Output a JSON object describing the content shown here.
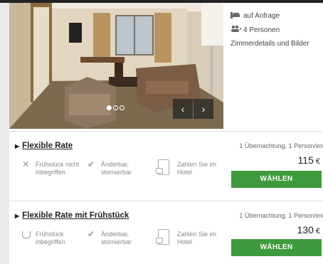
{
  "room": {
    "availability": "auf Anfrage",
    "capacity": "4 Personen",
    "details_link": "Zimmerdetails und Bilder",
    "gallery": {
      "slide_count": 3,
      "active_slide": 1
    }
  },
  "gallery_nav": {
    "prev": "‹",
    "next": "›"
  },
  "rates": [
    {
      "title": "Flexible Rate",
      "features": [
        {
          "icon": "x-icon",
          "text": "Frühstück nicht inbegriffen"
        },
        {
          "icon": "check-icon",
          "text": "Änderbar, stornierbar"
        },
        {
          "icon": "phone-hand-icon",
          "text": "Zahlen Sie im Hotel"
        }
      ],
      "per": "1 Übernachtung, 1 Person/en",
      "price": "115",
      "currency": "€",
      "button": "WÄHLEN"
    },
    {
      "title": "Flexible Rate mit Frühstück",
      "features": [
        {
          "icon": "cup-icon",
          "text": "Frühstück inbegriffen"
        },
        {
          "icon": "check-icon",
          "text": "Änderbar, stornierbar"
        },
        {
          "icon": "phone-hand-icon",
          "text": "Zahlen Sie im Hotel"
        }
      ],
      "per": "1 Übernachtung, 1 Person/en",
      "price": "130",
      "currency": "€",
      "button": "WÄHLEN"
    }
  ],
  "colors": {
    "button_green": "#3d9a3d",
    "top_bar": "#222222"
  }
}
